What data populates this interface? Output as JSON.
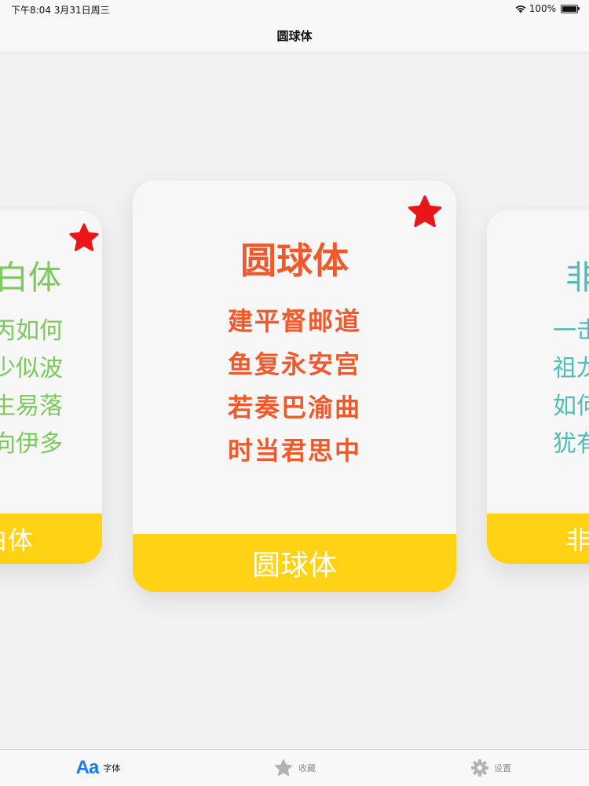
{
  "status_bar": {
    "time": "下午8:04   3月31日周三",
    "battery": "100%"
  },
  "nav": {
    "title": "圆球体"
  },
  "cards": {
    "left": {
      "name": "白体",
      "lines": [
        "丙如何",
        "少似波",
        "生易落",
        "向伊多"
      ],
      "footer": "白体",
      "favorited": true
    },
    "center": {
      "name": "圆球体",
      "lines": [
        "建平督邮道",
        "鱼复永安宫",
        "若奏巴渝曲",
        "时当君思中"
      ],
      "footer": "圆球体",
      "favorited": true
    },
    "right": {
      "name": "非",
      "lines": [
        "一击",
        "祖龙",
        "如何",
        "犹有"
      ],
      "footer": "非"
    }
  },
  "tabbar": {
    "items": [
      {
        "icon": "font-icon",
        "icon_text": "Aa",
        "label": "字体",
        "active": true
      },
      {
        "icon": "star-icon",
        "label": "收藏",
        "active": false
      },
      {
        "icon": "gear-icon",
        "label": "设置",
        "active": false
      }
    ]
  },
  "colors": {
    "accent_blue": "#1a7cf5",
    "card_footer_yellow": "#ffd214",
    "favorite_red": "#e81616",
    "center_text_orange": "#ef5a2d",
    "left_text_green": "#7cc95c",
    "right_text_teal": "#4fbdb8"
  }
}
